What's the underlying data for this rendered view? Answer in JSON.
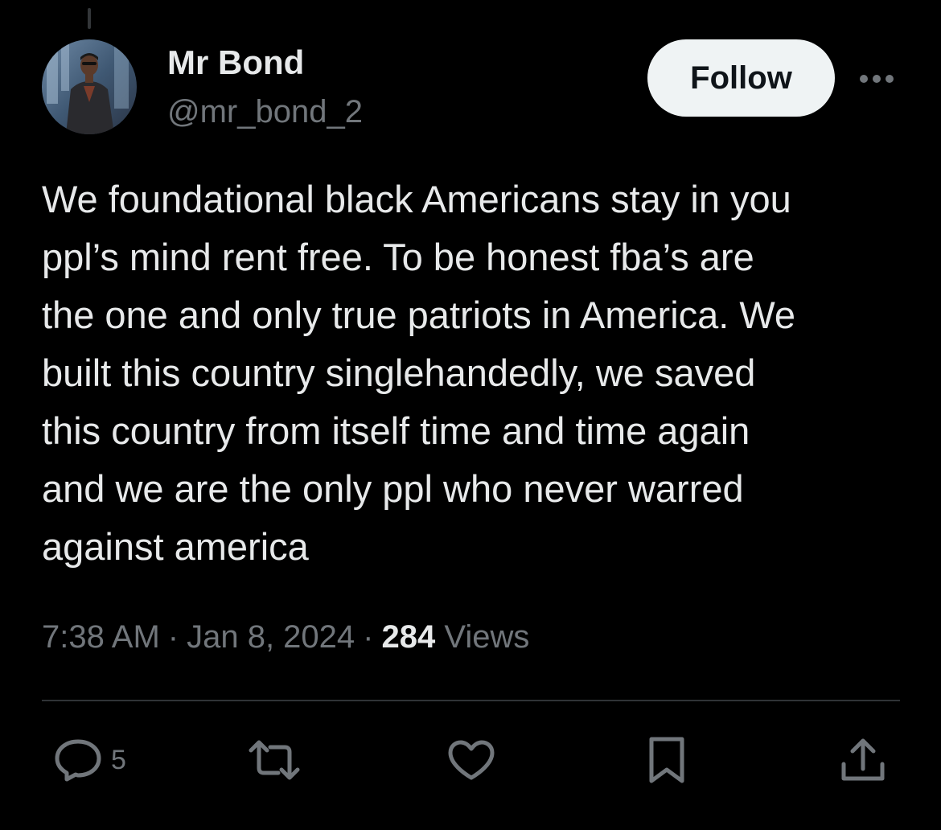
{
  "author": {
    "display_name": "Mr Bond",
    "handle": "@mr_bond_2",
    "avatar_icon": "profile-photo"
  },
  "follow_label": "Follow",
  "more_icon": "more-horizontal-icon",
  "tweet": {
    "lines": [
      "We foundational black Americans stay in you",
      "ppl’s mind rent free. To be honest fba’s are",
      "the one and only true patriots in America. We",
      "built this country singlehandedly, we saved",
      "this country from itself time and time again",
      "and we are the only ppl who never warred",
      "against america"
    ]
  },
  "meta": {
    "time": "7:38 AM",
    "separator": "·",
    "date": "Jan 8, 2024",
    "views_count": "284",
    "views_label": "Views"
  },
  "actions": {
    "reply": {
      "icon": "reply-icon",
      "count": "5"
    },
    "repost": {
      "icon": "repost-icon"
    },
    "like": {
      "icon": "heart-icon"
    },
    "bookmark": {
      "icon": "bookmark-icon"
    },
    "share": {
      "icon": "share-icon"
    }
  },
  "colors": {
    "background": "#000000",
    "text_primary": "#e7e9ea",
    "text_secondary": "#71767b",
    "follow_bg": "#eff3f4",
    "divider": "#2f3336"
  }
}
